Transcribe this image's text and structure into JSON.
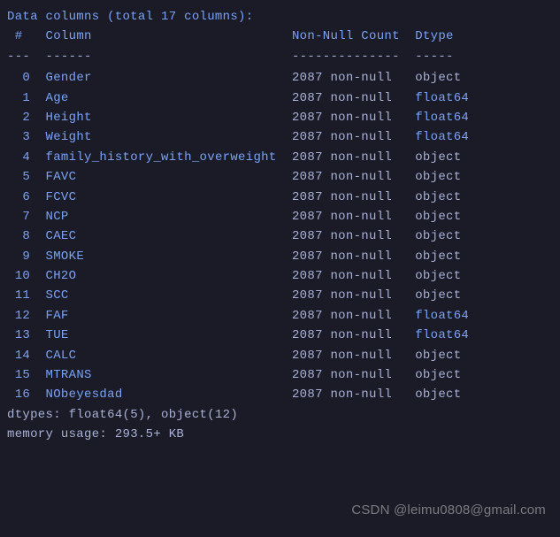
{
  "header": {
    "title": "Data columns (total 17 columns):"
  },
  "col_header": {
    "idx": " #",
    "column": "Column",
    "nncount": "Non-Null Count",
    "dtype": "Dtype"
  },
  "dashes": {
    "idx": "---",
    "column": "------",
    "nncount": "--------------",
    "dtype": "-----"
  },
  "columns": [
    {
      "idx": "0",
      "name": "Gender",
      "count": "2087",
      "nn": "non-null",
      "dtype": "object"
    },
    {
      "idx": "1",
      "name": "Age",
      "count": "2087",
      "nn": "non-null",
      "dtype": "float64"
    },
    {
      "idx": "2",
      "name": "Height",
      "count": "2087",
      "nn": "non-null",
      "dtype": "float64"
    },
    {
      "idx": "3",
      "name": "Weight",
      "count": "2087",
      "nn": "non-null",
      "dtype": "float64"
    },
    {
      "idx": "4",
      "name": "family_history_with_overweight",
      "count": "2087",
      "nn": "non-null",
      "dtype": "object"
    },
    {
      "idx": "5",
      "name": "FAVC",
      "count": "2087",
      "nn": "non-null",
      "dtype": "object"
    },
    {
      "idx": "6",
      "name": "FCVC",
      "count": "2087",
      "nn": "non-null",
      "dtype": "object"
    },
    {
      "idx": "7",
      "name": "NCP",
      "count": "2087",
      "nn": "non-null",
      "dtype": "object"
    },
    {
      "idx": "8",
      "name": "CAEC",
      "count": "2087",
      "nn": "non-null",
      "dtype": "object"
    },
    {
      "idx": "9",
      "name": "SMOKE",
      "count": "2087",
      "nn": "non-null",
      "dtype": "object"
    },
    {
      "idx": "10",
      "name": "CH2O",
      "count": "2087",
      "nn": "non-null",
      "dtype": "object"
    },
    {
      "idx": "11",
      "name": "SCC",
      "count": "2087",
      "nn": "non-null",
      "dtype": "object"
    },
    {
      "idx": "12",
      "name": "FAF",
      "count": "2087",
      "nn": "non-null",
      "dtype": "float64"
    },
    {
      "idx": "13",
      "name": "TUE",
      "count": "2087",
      "nn": "non-null",
      "dtype": "float64"
    },
    {
      "idx": "14",
      "name": "CALC",
      "count": "2087",
      "nn": "non-null",
      "dtype": "object"
    },
    {
      "idx": "15",
      "name": "MTRANS",
      "count": "2087",
      "nn": "non-null",
      "dtype": "object"
    },
    {
      "idx": "16",
      "name": "NObeyesdad",
      "count": "2087",
      "nn": "non-null",
      "dtype": "object"
    }
  ],
  "summary": {
    "dtypes": "dtypes: float64(5), object(12)",
    "memory": "memory usage: 293.5+ KB"
  },
  "watermark": "CSDN @leimu0808@gmail.com"
}
